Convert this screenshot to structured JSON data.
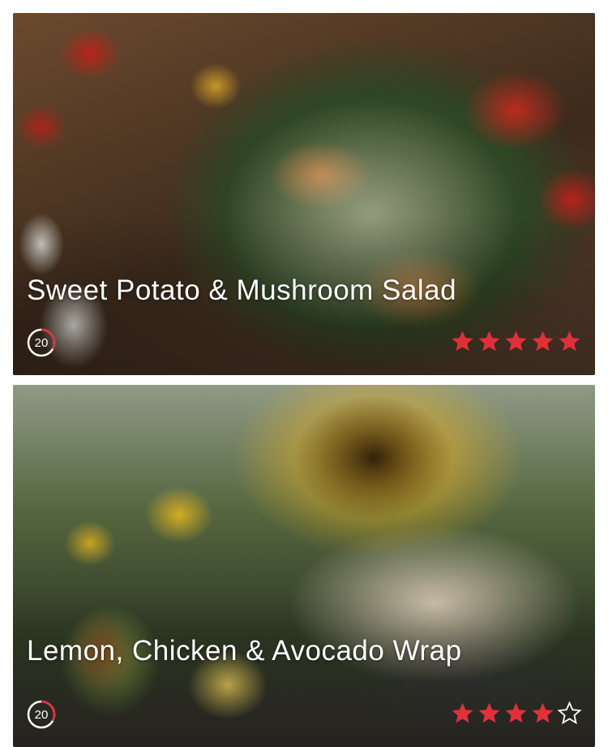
{
  "accent_color": "#e0303a",
  "recipes": [
    {
      "title": "Sweet Potato & Mushroom Salad",
      "time": "20",
      "timer_fraction": 0.33,
      "rating": 5,
      "rating_max": 5,
      "image": "salad-photo"
    },
    {
      "title": "Lemon, Chicken & Avocado Wrap",
      "time": "20",
      "timer_fraction": 0.33,
      "rating": 4,
      "rating_max": 5,
      "image": "wrap-photo"
    }
  ]
}
